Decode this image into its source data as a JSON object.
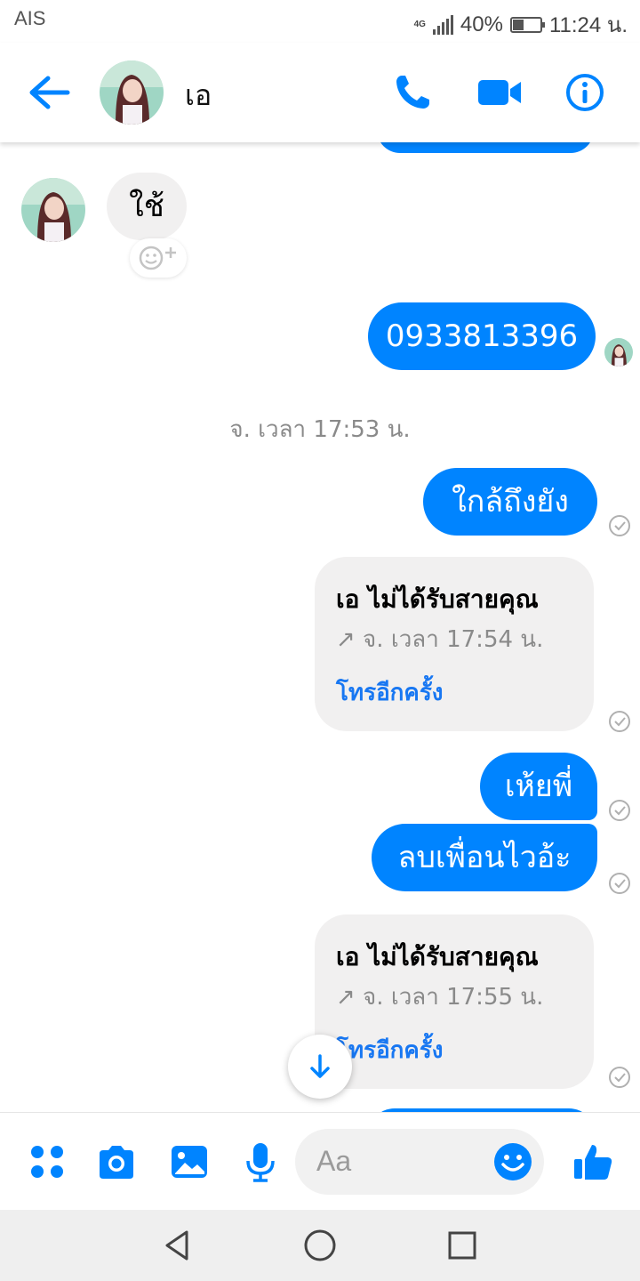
{
  "status_bar": {
    "carrier": "AIS",
    "network": "4G",
    "battery_percent": "40%",
    "battery_level": 0.4,
    "time": "11:24 น."
  },
  "header": {
    "contact_name": "เอ",
    "icons": [
      "back-arrow-icon",
      "phone-icon",
      "video-camera-icon",
      "info-icon"
    ]
  },
  "messages": {
    "incoming_1": "ใช้",
    "outgoing_phone": "0933813396",
    "timestamp": "จ. เวลา 17:53 น.",
    "outgoing_2": "ใกล้ถึงยัง",
    "missed_call_1": {
      "title": "เอ ไม่ได้รับสายคุณ",
      "time": "↗ จ. เวลา 17:54 น.",
      "action": "โทรอีกครั้ง"
    },
    "outgoing_3": "เห้ยพี่",
    "outgoing_4": "ลบเพื่อนไวอ้ะ",
    "missed_call_2": {
      "title": "เอ ไม่ได้รับสายคุณ",
      "time": "↗ จ. เวลา 17:55 น.",
      "action": "โทรอีกครั้ง"
    }
  },
  "composer": {
    "placeholder": "Aa",
    "icons": [
      "menu-dots-icon",
      "camera-icon",
      "gallery-icon",
      "microphone-icon",
      "emoji-icon",
      "like-icon"
    ]
  },
  "colors": {
    "accent": "#0084ff",
    "incoming_bubble": "#f1f0f0",
    "link": "#1877f2"
  }
}
